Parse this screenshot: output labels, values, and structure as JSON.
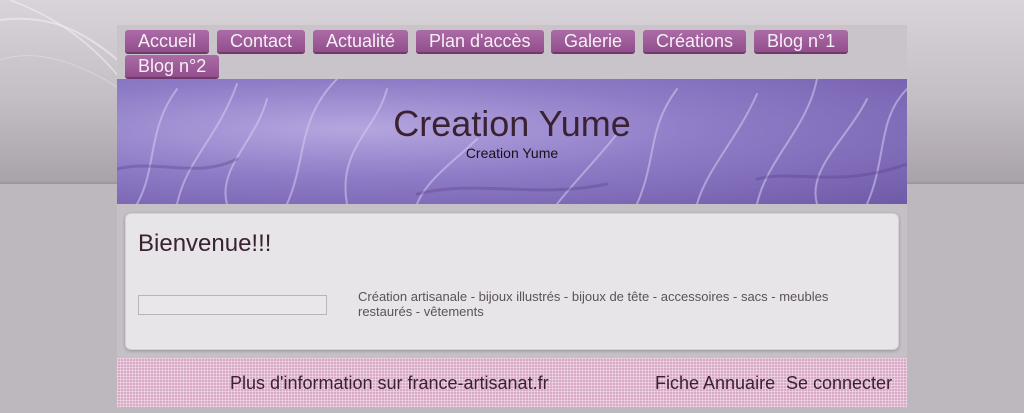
{
  "nav": {
    "items": [
      {
        "label": "Accueil"
      },
      {
        "label": "Contact"
      },
      {
        "label": "Actualité"
      },
      {
        "label": "Plan d'accès"
      },
      {
        "label": "Galerie"
      },
      {
        "label": "Créations"
      },
      {
        "label": "Blog n°1"
      },
      {
        "label": "Blog n°2"
      }
    ]
  },
  "header": {
    "title": "Creation Yume",
    "subtitle": "Creation Yume"
  },
  "main": {
    "heading": "Bienvenue!!!",
    "search_value": "",
    "description": "Création artisanale - bijoux illustrés - bijoux de tête - accessoires - sacs - meubles restaurés - vêtements"
  },
  "footer": {
    "info_link": "Plus d'information sur france-artisanat.fr",
    "directory_link": "Fiche Annuaire",
    "login_link": "Se connecter"
  },
  "colors": {
    "nav_button": "#9a5596",
    "title_text": "#3a2232",
    "footer_bg": "#d9a9c5",
    "banner": "#8f7cc7"
  }
}
